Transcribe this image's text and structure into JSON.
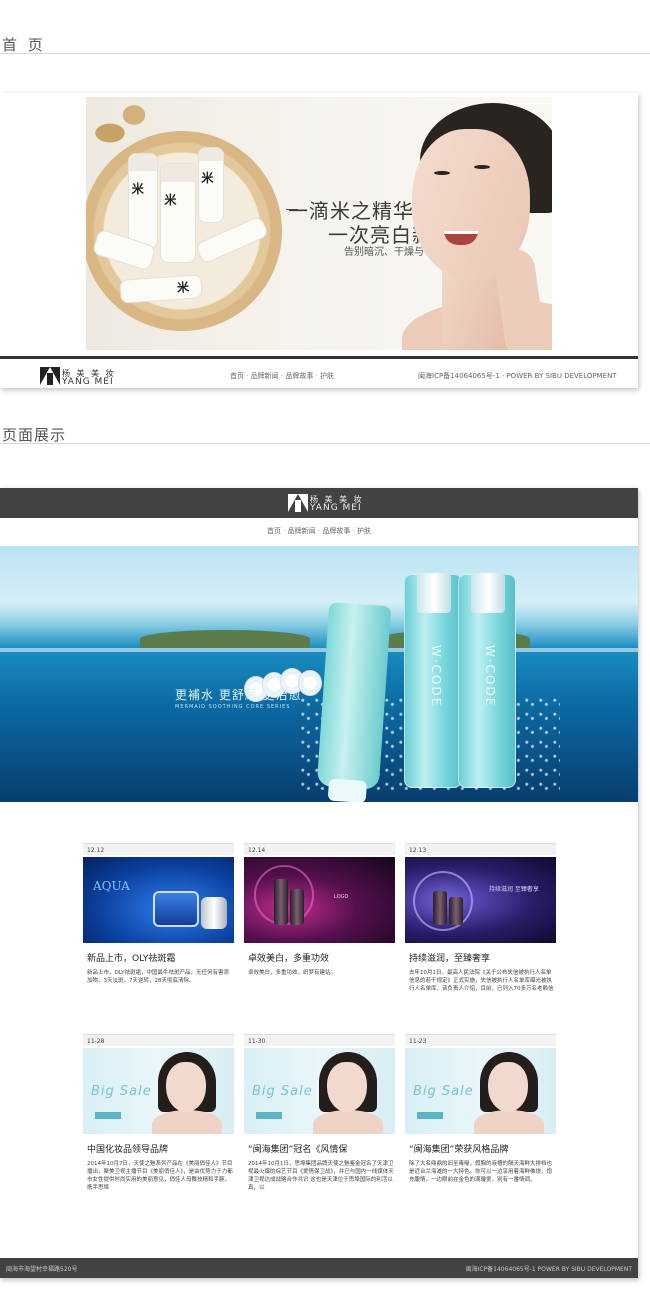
{
  "sections": {
    "home_title": "首 页",
    "show_title": "页面展示"
  },
  "home": {
    "slogan_line1": "一滴米之精华",
    "slogan_line2": "一次亮白新生",
    "slogan_line3": "告别暗沉、干燥与了无生机",
    "bottle_mark": "米",
    "logo_cn": "杨 美 美 妆",
    "logo_en": "YANG MEI",
    "nav": [
      "首页",
      "品牌新闻",
      "品牌故事",
      "护肤"
    ],
    "icp": "闽海ICP备14064065号-1 · POWER BY SIBU DEVELOPMENT"
  },
  "showcase": {
    "logo_cn": "杨 美 美 妆",
    "logo_en": "YANG MEI",
    "nav": [
      "首页",
      "品牌新闻",
      "品牌故事",
      "护肤"
    ],
    "banner_slogan": "更補水 更舒緩 更治愈",
    "banner_sub": "MERMAID SOOTHING CORE SERIES",
    "bottle_label": "W·CODE",
    "cards": [
      {
        "date": "12.12",
        "title": "新品上市，OLY祛斑霜",
        "desc": "新品上市，OLY祛斑霜，中国最牛祛斑产品，无任何有害添加物，3天淡斑，7天逆转，28天彻底清除。",
        "img_text": "AQUA"
      },
      {
        "date": "12.14",
        "title": "卓效美白，多重功效",
        "desc": "卓效美白，多重功效，织梦有建站。",
        "img_text": "LOGO"
      },
      {
        "date": "12.13",
        "title": "持续滋润，至臻奢享",
        "desc": "去年10月1日，最高人民法院《关于公布失信被执行人名单信息的若干规定》正式实施，失信被执行人名单库曝光被执行人名单库，该负责人介绍，目前，已列入70多万名老赖信",
        "img_text": "持续滋润 至臻奢享"
      },
      {
        "date": "11-28",
        "title": "中国化妆品领导品牌",
        "desc": "2014年10月7日，天使之魅系列产品在《美丽俏佳人》节目播出，聚美卫视主播节目《美丽俏佳人》，是由优势力于力都市女性提供时尚实用的美丽意见，俏佳人母舞技精和手腕，携手思埠",
        "img_text": "Big Sale"
      },
      {
        "date": "11-30",
        "title": "“闽海集团”冠名《风情保",
        "desc": "2014年10月1日，思埠集团品牌天使之魅鉴金冠名了天津卫视最火爆的综艺节目《爱情保卫战》，并已与国内一线媒体天津卫视达成战略合作共识 这也是天津位于思埠国际的利活以真，以",
        "img_text": "Big Sale"
      },
      {
        "date": "11-23",
        "title": "“闽海集团”荣获风格品牌",
        "desc": "除了大名鼎鼎的旧至毒喙，假胸的液槽的隔天海鲜大排档也是近台兰海滩的一大特色。你可以一边享用着海鲜佛烧，饱充腹情，一边眼前在金色的满瓊爱，别有一番情调。",
        "img_text": "Big Sale"
      }
    ],
    "footer_left": "闽海市海望村幸福路520号",
    "footer_right": "闽海ICP备14064065号-1    POWER BY SIBU DEVELOPMENT"
  }
}
